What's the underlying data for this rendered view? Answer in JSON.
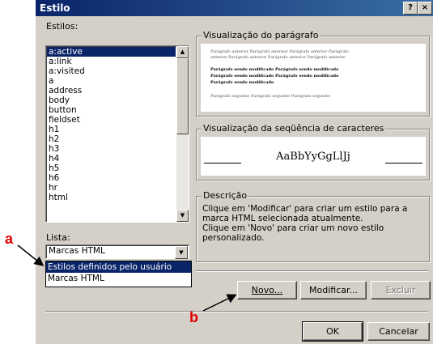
{
  "window": {
    "title": "Estilo",
    "help_btn": "?",
    "close_btn": "×"
  },
  "styles": {
    "label": "Estilos:",
    "items": [
      "a:active",
      "a:link",
      "a:visited",
      "a",
      "address",
      "body",
      "button",
      "fieldset",
      "h1",
      "h2",
      "h3",
      "h4",
      "h5",
      "h6",
      "hr",
      "html"
    ],
    "selected_index": 0
  },
  "list": {
    "label": "Lista:",
    "value": "Marcas HTML",
    "options": [
      "Estilos definidos pelo usuário",
      "Marcas HTML"
    ],
    "highlighted_index": 0
  },
  "paragraph_preview": {
    "label": "Visualização do parágrafo",
    "prev_lines": [
      "Parágrafo anterior Parágrafo anterior Parágrafo anterior Parágrafo",
      "anterior Parágrafo anterior Parágrafo anterior Parágrafo anterior"
    ],
    "mod_lines": [
      "Parágrafo sendo modificado Parágrafo sendo modificado",
      "Parágrafo sendo modificado Parágrafo sendo modificado",
      "Parágrafo sendo modificado"
    ],
    "next_lines": [
      "Parágrafo seguinte Parágrafo seguinte Parágrafo seguinte"
    ]
  },
  "char_preview": {
    "label": "Visualização da seqüência de caracteres",
    "sample": "AaBbYyGgLlJj"
  },
  "description": {
    "label": "Descrição",
    "text": "Clique em 'Modificar' para criar um estilo para a marca HTML selecionada atualmente.\nClique em 'Novo' para criar um novo estilo personalizado."
  },
  "buttons": {
    "new": "Novo...",
    "modify": "Modificar...",
    "delete": "Excluir",
    "ok": "OK",
    "cancel": "Cancelar"
  },
  "annotations": {
    "a": "a",
    "b": "b"
  },
  "colors": {
    "annotation": "#e00000",
    "selection": "#0a246a",
    "dialog_bg": "#d4d0c8"
  }
}
